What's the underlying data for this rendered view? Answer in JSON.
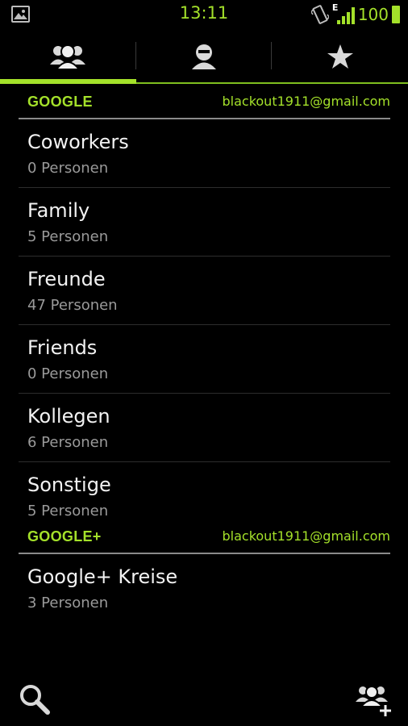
{
  "status_bar": {
    "time": "13:11",
    "network_type": "E",
    "battery_level": "100",
    "icons": [
      "gallery-icon",
      "vibrate-icon",
      "signal-icon",
      "battery-icon"
    ]
  },
  "tabs": [
    {
      "name": "groups",
      "icon": "group-icon",
      "active": true
    },
    {
      "name": "contacts",
      "icon": "person-icon",
      "active": false
    },
    {
      "name": "favorites",
      "icon": "star-icon",
      "active": false
    }
  ],
  "sections": [
    {
      "title": "GOOGLE",
      "account": "blackout1911@gmail.com",
      "groups": [
        {
          "name": "Coworkers",
          "count": "0 Personen"
        },
        {
          "name": "Family",
          "count": "5 Personen"
        },
        {
          "name": "Freunde",
          "count": "47 Personen"
        },
        {
          "name": "Friends",
          "count": "0 Personen"
        },
        {
          "name": "Kollegen",
          "count": "6 Personen"
        },
        {
          "name": "Sonstige",
          "count": "5 Personen"
        }
      ]
    },
    {
      "title": "GOOGLE+",
      "account": "blackout1911@gmail.com",
      "groups": [
        {
          "name": "Google+ Kreise",
          "count": "3 Personen"
        }
      ]
    }
  ],
  "bottom_bar": {
    "actions": [
      "search-icon",
      "add-group-icon"
    ]
  },
  "colors": {
    "accent": "#a4e12a",
    "background": "#000000",
    "secondary_text": "#9a9a9a"
  }
}
